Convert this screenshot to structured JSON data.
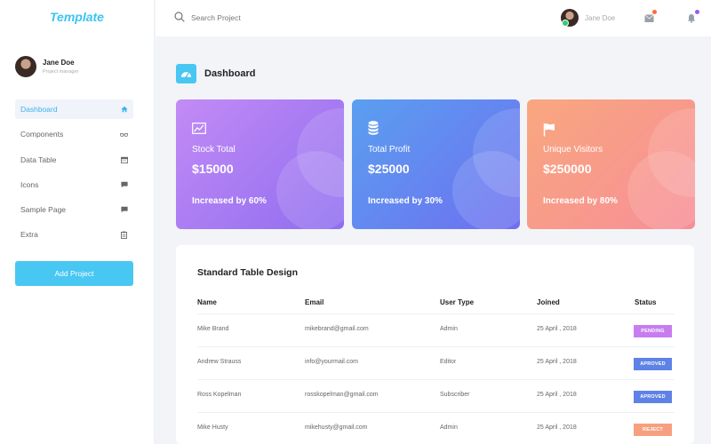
{
  "app": {
    "logo": "Template"
  },
  "profile": {
    "name": "Jane Doe",
    "role": "Project manager"
  },
  "sidebar": {
    "items": [
      {
        "label": "Dashboard",
        "icon": "home-icon",
        "active": true
      },
      {
        "label": "Components",
        "icon": "glasses-icon",
        "active": false
      },
      {
        "label": "Data Table",
        "icon": "calendar-icon",
        "active": false
      },
      {
        "label": "Icons",
        "icon": "chat-icon",
        "active": false
      },
      {
        "label": "Sample Page",
        "icon": "chat-icon",
        "active": false
      },
      {
        "label": "Extra",
        "icon": "clipboard-icon",
        "active": false
      }
    ],
    "add_button": "Add Project"
  },
  "topbar": {
    "search_placeholder": "Search Project",
    "user_name": "Jane Doe",
    "mail_dot_color": "#ff6b3d",
    "bell_dot_color": "#9b59f5"
  },
  "page": {
    "title": "Dashboard",
    "icon": "speedometer-icon"
  },
  "cards": [
    {
      "label": "Stock Total",
      "value": "$15000",
      "increase": "Increased by 60%",
      "icon": "chart-icon",
      "gradient": [
        "#c38bf5",
        "#8f6df0"
      ]
    },
    {
      "label": "Total Profit",
      "value": "$25000",
      "increase": "Increased by 30%",
      "icon": "database-icon",
      "gradient": [
        "#5a9ff0",
        "#6e6ff0"
      ]
    },
    {
      "label": "Unique Visitors",
      "value": "$250000",
      "increase": "Increased by 80%",
      "icon": "flag-icon",
      "gradient": [
        "#f9a77f",
        "#f78e97"
      ]
    }
  ],
  "table": {
    "title": "Standard Table Design",
    "headers": [
      "Name",
      "Email",
      "User Type",
      "Joined",
      "Status"
    ],
    "rows": [
      {
        "name": "Mike Brand",
        "email": "mikebrand@gmail.com",
        "type": "Admin",
        "joined": "25 April , 2018",
        "status": "PENDING",
        "status_color": "#c77df0"
      },
      {
        "name": "Andrew Strauss",
        "email": "info@yourmail.com",
        "type": "Editor",
        "joined": "25 April , 2018",
        "status": "APROVED",
        "status_color": "#5f82e6"
      },
      {
        "name": "Ross Kopelman",
        "email": "rosskopelman@gmail.com",
        "type": "Subscriber",
        "joined": "25 April , 2018",
        "status": "APROVED",
        "status_color": "#5f82e6"
      },
      {
        "name": "Mike Husty",
        "email": "mikehusty@gmail.com",
        "type": "Admin",
        "joined": "25 April , 2018",
        "status": "REJECT",
        "status_color": "#f7a07f"
      }
    ]
  }
}
